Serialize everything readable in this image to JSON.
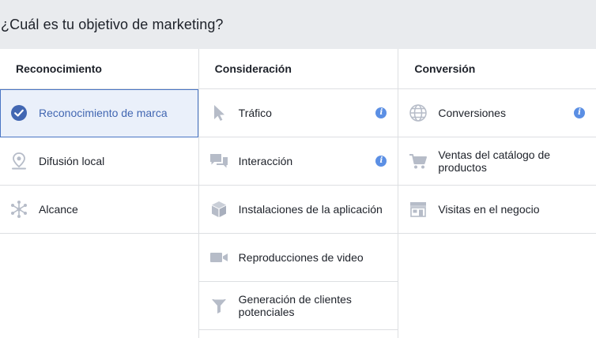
{
  "header": {
    "title": "¿Cuál es tu objetivo de marketing?"
  },
  "columns": [
    {
      "heading": "Reconocimiento",
      "items": [
        {
          "label": "Reconocimiento de marca",
          "icon": "check-circle-icon"
        },
        {
          "label": "Difusión local",
          "icon": "location-pin-icon"
        },
        {
          "label": "Alcance",
          "icon": "reach-burst-icon"
        }
      ]
    },
    {
      "heading": "Consideración",
      "items": [
        {
          "label": "Tráfico",
          "icon": "cursor-icon"
        },
        {
          "label": "Interacción",
          "icon": "chat-bubbles-icon"
        },
        {
          "label": "Instalaciones de la aplicación",
          "icon": "box-icon"
        },
        {
          "label": "Reproducciones de video",
          "icon": "video-camera-icon"
        },
        {
          "label": "Generación de clientes potenciales",
          "icon": "funnel-icon"
        }
      ]
    },
    {
      "heading": "Conversión",
      "items": [
        {
          "label": "Conversiones",
          "icon": "globe-icon"
        },
        {
          "label": "Ventas del catálogo de productos",
          "icon": "shopping-cart-icon"
        },
        {
          "label": "Visitas en el negocio",
          "icon": "storefront-icon"
        }
      ]
    }
  ],
  "info_icon_glyph": "i",
  "colors": {
    "header_bg": "#e9ebee",
    "border": "#dddfe2",
    "selected_bg": "#eaf0fa",
    "selected_text": "#4267b2",
    "icon_gray": "#b6bcc8",
    "info_blue": "#5b8fe4"
  }
}
